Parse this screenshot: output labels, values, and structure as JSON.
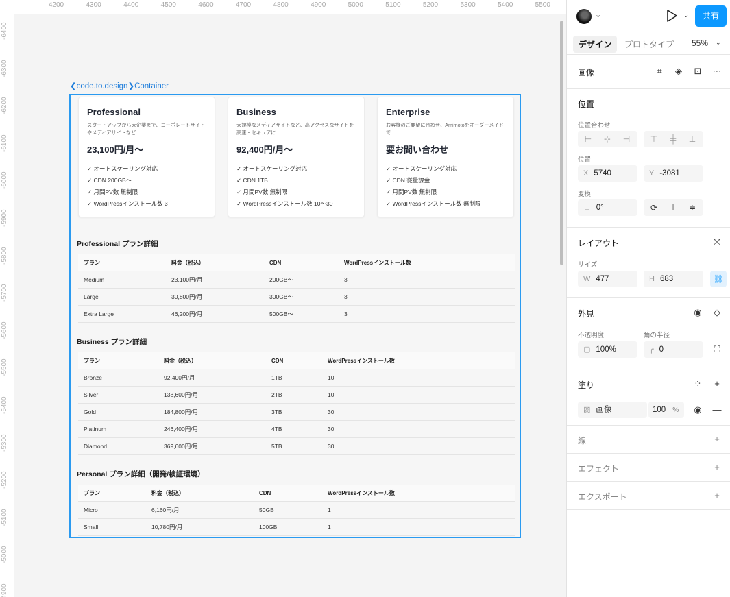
{
  "ruler": {
    "top": [
      "4200",
      "4300",
      "4400",
      "4500",
      "4600",
      "4700",
      "4800",
      "4900",
      "5000",
      "5100",
      "5200",
      "5300",
      "5400",
      "5500"
    ],
    "left": [
      "-6400",
      "-6300",
      "-6200",
      "-6100",
      "-6000",
      "-5900",
      "-5800",
      "-5700",
      "-5600",
      "-5500",
      "-5400",
      "-5300",
      "-5200",
      "-5100",
      "-5000",
      "-4900"
    ]
  },
  "canvas": {
    "frame_label": "❮code.to.design❯Container",
    "cards": [
      {
        "title": "Professional",
        "desc": "スタートアップから大企業まで、コーポレートサイトやメディアサイトなど",
        "price": "23,100円/月〜",
        "features": [
          "✓ オートスケーリング対応",
          "✓ CDN 200GB〜",
          "✓ 月間PV数 無制限",
          "✓ WordPressインストール数 3"
        ]
      },
      {
        "title": "Business",
        "desc": "大規模なメディアサイトなど、高アクセスなサイトを高速・セキュアに",
        "price": "92,400円/月〜",
        "features": [
          "✓ オートスケーリング対応",
          "✓ CDN 1TB",
          "✓ 月間PV数 無制限",
          "✓ WordPressインストール数 10〜30"
        ]
      },
      {
        "title": "Enterprise",
        "desc": "お客様のご要望に合わせ、Amimotoをオーダーメイドで",
        "price": "要お問い合わせ",
        "features": [
          "✓ オートスケーリング対応",
          "✓ CDN 従量課金",
          "✓ 月間PV数 無制限",
          "✓ WordPressインストール数 無制限"
        ]
      }
    ],
    "sections": [
      {
        "title": "Professional プラン詳細",
        "headers": [
          "プラン",
          "料金（税込）",
          "CDN",
          "WordPressインストール数"
        ],
        "rows": [
          [
            "Medium",
            "23,100円/月",
            "200GB〜",
            "3"
          ],
          [
            "Large",
            "30,800円/月",
            "300GB〜",
            "3"
          ],
          [
            "Extra Large",
            "46,200円/月",
            "500GB〜",
            "3"
          ]
        ]
      },
      {
        "title": "Business プラン詳細",
        "headers": [
          "プラン",
          "料金（税込）",
          "CDN",
          "WordPressインストール数"
        ],
        "rows": [
          [
            "Bronze",
            "92,400円/月",
            "1TB",
            "10"
          ],
          [
            "Silver",
            "138,600円/月",
            "2TB",
            "10"
          ],
          [
            "Gold",
            "184,800円/月",
            "3TB",
            "30"
          ],
          [
            "Platinum",
            "246,400円/月",
            "4TB",
            "30"
          ],
          [
            "Diamond",
            "369,600円/月",
            "5TB",
            "30"
          ]
        ]
      },
      {
        "title": "Personal プラン詳細（開発/検証環境）",
        "headers": [
          "プラン",
          "料金（税込）",
          "CDN",
          "WordPressインストール数"
        ],
        "rows": [
          [
            "Micro",
            "6,160円/月",
            "50GB",
            "1"
          ],
          [
            "Small",
            "10,780円/月",
            "100GB",
            "1"
          ]
        ]
      }
    ]
  },
  "panel": {
    "share": "共有",
    "tabs": {
      "design": "デザイン",
      "prototype": "プロトタイプ"
    },
    "zoom": "55%",
    "layer_type": "画像",
    "position": {
      "title": "位置",
      "align_label": "位置合わせ",
      "pos_label": "位置",
      "x_prefix": "X",
      "x": "5740",
      "y_prefix": "Y",
      "y": "-3081",
      "transform_label": "変換",
      "rotation": "0°"
    },
    "layout": {
      "title": "レイアウト",
      "size_label": "サイズ",
      "w_prefix": "W",
      "w": "477",
      "h_prefix": "H",
      "h": "683"
    },
    "appearance": {
      "title": "外見",
      "opacity_label": "不透明度",
      "opacity": "100%",
      "radius_label": "角の半径",
      "radius": "0"
    },
    "fill": {
      "title": "塗り",
      "name": "画像",
      "value": "100",
      "unit": "%"
    },
    "stroke": "線",
    "effects": "エフェクト",
    "export": "エクスポート"
  }
}
